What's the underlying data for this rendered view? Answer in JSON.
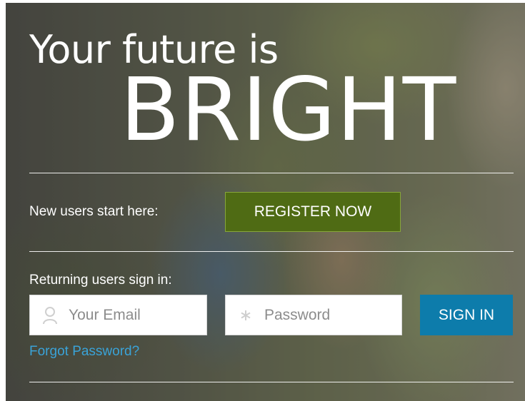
{
  "hero": {
    "line1": "Your future is",
    "line2": "BRIGHT"
  },
  "register": {
    "label": "New users start here:",
    "button": "REGISTER NOW",
    "button_color": "#4f6b14"
  },
  "signin": {
    "label": "Returning users sign in:",
    "email_placeholder": "Your Email",
    "email_icon": "user-icon",
    "password_placeholder": "Password",
    "password_icon": "asterisk-icon",
    "button": "SIGN IN",
    "button_color": "#0d7cab",
    "forgot_link": "Forgot Password?",
    "link_color": "#3aa3d8"
  }
}
